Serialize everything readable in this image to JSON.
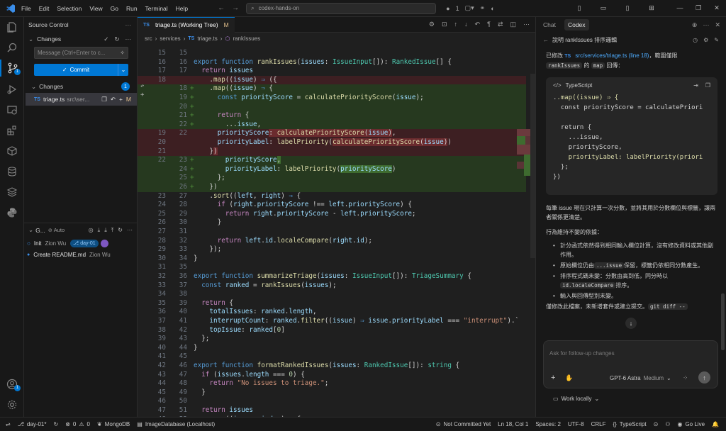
{
  "titlebar": {
    "menu": [
      "File",
      "Edit",
      "Selection",
      "View",
      "Go",
      "Run",
      "Terminal",
      "Help"
    ],
    "search_text": "codex-hands-on",
    "dot_count": "1"
  },
  "activity": {
    "scm_badge": "1",
    "account_badge": "1"
  },
  "sidebar": {
    "title": "Source Control",
    "changes_header": "Changes",
    "message_placeholder": "Message (Ctrl+Enter to c...",
    "commit_label": "Commit",
    "changes_group": "Changes",
    "changes_count": "1",
    "file_name": "triage.ts",
    "file_path": "src\\ser...",
    "file_status": "M",
    "graph_title": "G...",
    "graph_auto": "Auto",
    "commits": [
      {
        "msg": "Init",
        "author": "Zion Wu",
        "branch": "day-01"
      },
      {
        "msg": "Create README.md",
        "author": "Zion Wu"
      }
    ]
  },
  "editor": {
    "tab_label": "triage.ts (Working Tree)",
    "tab_status": "M",
    "crumbs": [
      "src",
      "services",
      "triage.ts",
      "rankIssues"
    ]
  },
  "chat": {
    "tabs": [
      "Chat",
      "Codex"
    ],
    "thread_title": "說明 rankIssues 排序邏輯",
    "intro_a": "已修改",
    "intro_link": "src/services/triage.ts (line 18)",
    "intro_b": "，範圍僅限",
    "intro_chip1": "rankIssues",
    "intro_c": "的",
    "intro_chip2": "map",
    "intro_d": "回傳：",
    "code_lang": "TypeScript",
    "code_lines": [
      ".map((issue) ⇒ {",
      "  const priorityScore = calculatePriori",
      "",
      "  return {",
      "    ...issue,",
      "    priorityScore,",
      "    priorityLabel: labelPriority(priori",
      "  };",
      "})"
    ],
    "para1": "每筆 issue 現在只計算一次分數，並將其用於分數欄位與標籤，讓兩者關係更清楚。",
    "para2": "行為維持不變的依據：",
    "bullet1": "計分函式依然得到相同輸入欄位計算，沒有修改資料或其他副作用。",
    "bullet2_a": "原始欄位仍由",
    "bullet2_chip": "...issue",
    "bullet2_b": "保留，標籤仍依相同分數產生。",
    "bullet3_a": "排序程式碼未變：分數由高到低，同分時以",
    "bullet3_chip": "id.localeCompare",
    "bullet3_b": "排序。",
    "bullet4": "輸入與回傳型別未變。",
    "para3_a": "僅修改此檔案，未新增套件或建立提交。",
    "para3_chip": "git diff --",
    "composer_placeholder": "Ask for follow-up changes",
    "model": "GPT-6 Astra",
    "effort": "Medium",
    "work_mode": "Work locally"
  },
  "status": {
    "branch": "day-01*",
    "errors": "0",
    "warnings": "0",
    "mongo": "MongoDB",
    "db": "ImageDatabase (Localhost)",
    "commit_state": "Not Committed Yet",
    "position": "Ln 18, Col 1",
    "spaces": "Spaces: 2",
    "encoding": "UTF-8",
    "eol": "CRLF",
    "language": "TypeScript",
    "golive": "Go Live"
  }
}
